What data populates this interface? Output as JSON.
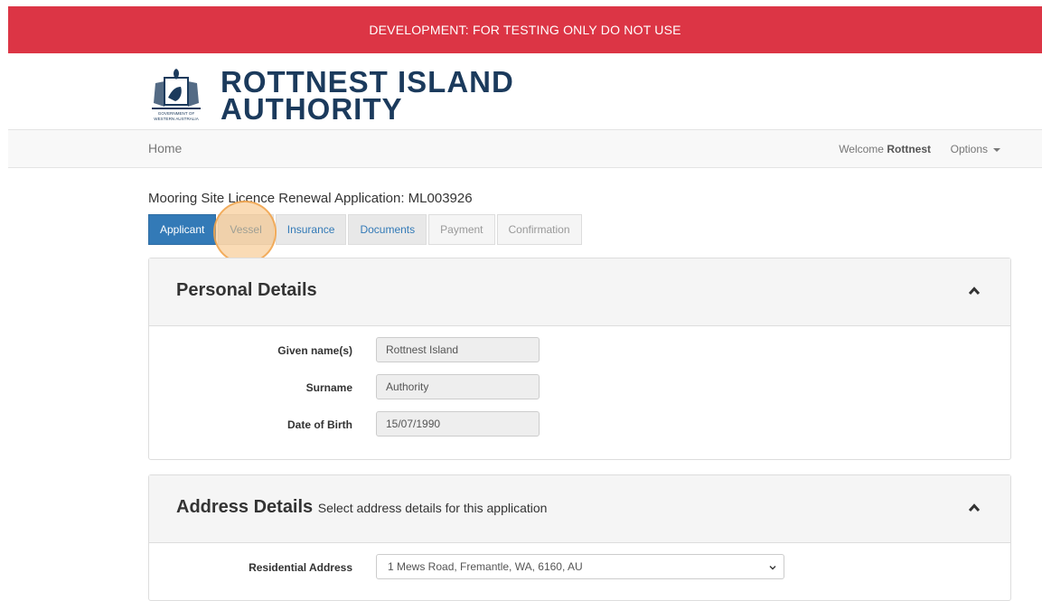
{
  "banner": {
    "text": "DEVELOPMENT: FOR TESTING ONLY DO NOT USE",
    "color": "#dc3545"
  },
  "logo": {
    "line1": "ROTTNEST ISLAND",
    "line2": "AUTHORITY",
    "crest_caption_1": "GOVERNMENT OF",
    "crest_caption_2": "WESTERN AUSTRALIA",
    "color": "#1b3a5c"
  },
  "navbar": {
    "home": "Home",
    "welcome_prefix": "Welcome",
    "user": "Rottnest",
    "options": "Options"
  },
  "application": {
    "title": "Mooring Site Licence Renewal Application: ML003926",
    "tabs": [
      {
        "label": "Applicant",
        "state": "active"
      },
      {
        "label": "Vessel",
        "state": "visited"
      },
      {
        "label": "Insurance",
        "state": "visited"
      },
      {
        "label": "Documents",
        "state": "visited"
      },
      {
        "label": "Payment",
        "state": "disabled"
      },
      {
        "label": "Confirmation",
        "state": "disabled"
      }
    ]
  },
  "personal_details": {
    "title": "Personal Details",
    "fields": [
      {
        "label": "Given name(s)",
        "value": "Rottnest Island"
      },
      {
        "label": "Surname",
        "value": "Authority"
      },
      {
        "label": "Date of Birth",
        "value": "15/07/1990"
      }
    ]
  },
  "address_details": {
    "title": "Address Details",
    "subtitle": "Select address details for this application",
    "residential_label": "Residential Address",
    "residential_value": "1 Mews Road, Fremantle, WA, 6160, AU"
  },
  "icons": {
    "collapse": "chevron-up-icon",
    "select": "chevron-down-icon",
    "crest": "crest-icon"
  }
}
